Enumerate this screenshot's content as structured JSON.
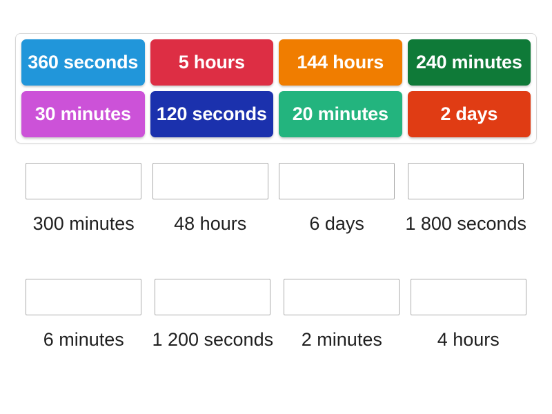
{
  "activity": {
    "type": "drag-and-drop-matching",
    "tray": {
      "tiles": [
        {
          "label": "360 seconds",
          "color": "#2196da"
        },
        {
          "label": "5 hours",
          "color": "#dd2e44"
        },
        {
          "label": "144 hours",
          "color": "#f07d00"
        },
        {
          "label": "240 minutes",
          "color": "#0f7a38"
        },
        {
          "label": "30 minutes",
          "color": "#cc52d8"
        },
        {
          "label": "120 seconds",
          "color": "#1b31ad"
        },
        {
          "label": "20 minutes",
          "color": "#23b47e"
        },
        {
          "label": "2 days",
          "color": "#e03c14"
        }
      ]
    },
    "dropzones": {
      "rows": [
        {
          "cells": [
            {
              "label": "300 minutes",
              "value": ""
            },
            {
              "label": "48 hours",
              "value": ""
            },
            {
              "label": "6 days",
              "value": ""
            },
            {
              "label": "1 800 seconds",
              "value": ""
            }
          ]
        },
        {
          "cells": [
            {
              "label": "6 minutes",
              "value": ""
            },
            {
              "label": "1 200 seconds",
              "value": ""
            },
            {
              "label": "2 minutes",
              "value": ""
            },
            {
              "label": "4 hours",
              "value": ""
            }
          ]
        }
      ]
    }
  },
  "colors": {
    "page_background": "#ffffff",
    "tray_border": "#d8d8d8",
    "dropzone_border": "#aaaaaa",
    "label_text": "#1f1f1f",
    "tile_text": "#ffffff"
  }
}
